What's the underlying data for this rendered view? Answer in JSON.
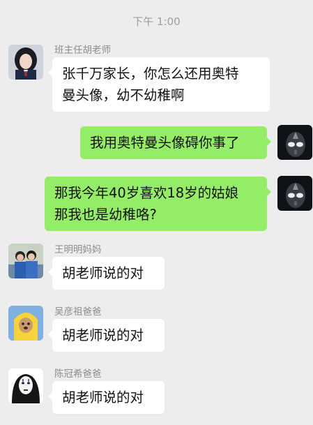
{
  "timestamp": "下午 1:00",
  "messages": [
    {
      "sender": "班主任胡老师",
      "direction": "incoming",
      "avatar_icon": "student-girl-avatar-icon",
      "lines": [
        "张千万家长，你怎么还用奥特",
        "曼头像，幼不幼稚啊"
      ]
    },
    {
      "sender": "",
      "direction": "outgoing",
      "avatar_icon": "ultraman-avatar-icon",
      "lines": [
        "我用奥特曼头像碍你事了"
      ]
    },
    {
      "sender": "",
      "direction": "outgoing",
      "avatar_icon": "ultraman-avatar-icon",
      "lines": [
        "那我今年40岁喜欢18岁的姑娘",
        "那我也是幼稚咯?"
      ]
    },
    {
      "sender": "王明明妈妈",
      "direction": "incoming",
      "avatar_icon": "couple-photo-avatar-icon",
      "lines": [
        "胡老师说的对"
      ]
    },
    {
      "sender": "吴彦祖爸爸",
      "direction": "incoming",
      "avatar_icon": "yellow-raincoat-dog-avatar-icon",
      "lines": [
        "胡老师说的对"
      ]
    },
    {
      "sender": "陈冠希爸爸",
      "direction": "incoming",
      "avatar_icon": "no-face-avatar-icon",
      "lines": [
        "胡老师说的对"
      ]
    }
  ],
  "colors": {
    "background": "#ededed",
    "incoming_bubble": "#ffffff",
    "outgoing_bubble": "#95ec69",
    "timestamp_text": "#9e9e9e",
    "sender_text": "#8c8c8c"
  }
}
